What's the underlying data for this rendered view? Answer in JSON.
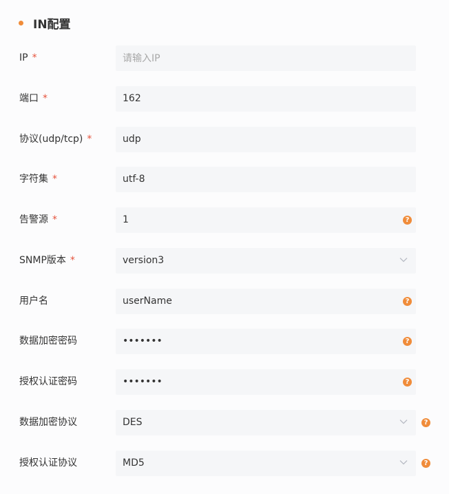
{
  "section": {
    "title": "IN配置"
  },
  "fields": {
    "ip": {
      "label": "IP",
      "required": "*",
      "placeholder": "请输入IP",
      "value": ""
    },
    "port": {
      "label": "端口",
      "required": "*",
      "value": "162"
    },
    "protocol": {
      "label": "协议(udp/tcp)",
      "required": "*",
      "value": "udp"
    },
    "charset": {
      "label": "字符集",
      "required": "*",
      "value": "utf-8"
    },
    "alarm_source": {
      "label": "告警源",
      "required": "*",
      "value": "1",
      "help_icon": "question-icon"
    },
    "snmp_version": {
      "label": "SNMP版本",
      "required": "*",
      "value": "version3",
      "icon": "chevron-down-icon"
    },
    "username": {
      "label": "用户名",
      "value": "userName",
      "help_icon": "question-icon"
    },
    "encrypt_pwd": {
      "label": "数据加密密码",
      "value": "•••••••",
      "help_icon": "question-icon"
    },
    "auth_pwd": {
      "label": "授权认证密码",
      "value": "•••••••",
      "help_icon": "question-icon"
    },
    "encrypt_protocol": {
      "label": "数据加密协议",
      "value": "DES",
      "icon": "chevron-down-icon",
      "help_icon": "question-icon"
    },
    "auth_protocol": {
      "label": "授权认证协议",
      "value": "MD5",
      "icon": "chevron-down-icon",
      "help_icon": "question-icon"
    }
  },
  "help_glyph": "?",
  "colors": {
    "accent": "#f08c3a",
    "required": "#e5533d",
    "field_bg": "#f5f6f8"
  }
}
